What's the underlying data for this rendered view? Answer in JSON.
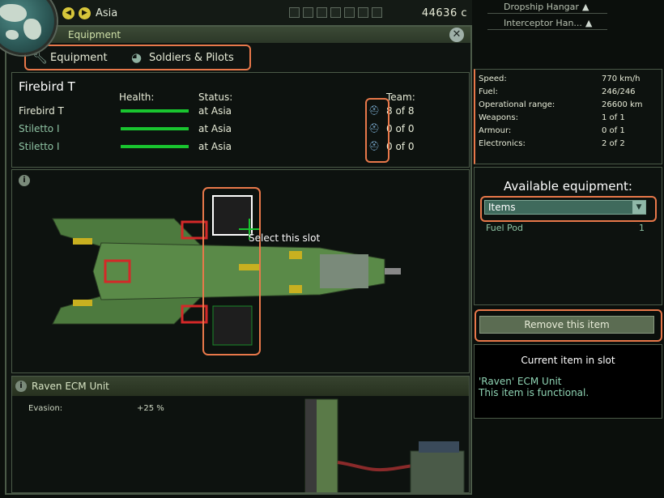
{
  "topbar": {
    "region": "Asia",
    "credits": "44636 c",
    "prev_icon": "left-arrow-icon",
    "next_icon": "right-arrow-icon"
  },
  "hangars": [
    {
      "label": "Dropship Hangar",
      "icon": "dropship-icon"
    },
    {
      "label": "Interceptor Han...",
      "icon": "interceptor-icon"
    }
  ],
  "panel": {
    "title": "Equipment",
    "tabs": [
      {
        "label": "Equipment",
        "icon": "wrench-icon"
      },
      {
        "label": "Soldiers & Pilots",
        "icon": "helmet-icon"
      }
    ]
  },
  "team": {
    "craft_title": "Firebird T",
    "headers": {
      "health": "Health:",
      "status": "Status:",
      "team": "Team:"
    },
    "rows": [
      {
        "name": "Firebird T",
        "health": 1.0,
        "status": "at Asia",
        "team": "8 of 8",
        "name_color": "#e8ecd8"
      },
      {
        "name": "Stiletto I",
        "health": 1.0,
        "status": "at Asia",
        "team": "0 of 0",
        "name_color": "#8fc4a4"
      },
      {
        "name": "Stiletto I",
        "health": 1.0,
        "status": "at Asia",
        "team": "0 of 0",
        "name_color": "#8fc4a4"
      }
    ]
  },
  "aircraft_view": {
    "slot_label": "Select this slot"
  },
  "item_detail": {
    "title": "Raven ECM Unit",
    "stat_label": "Evasion:",
    "stat_value": "+25 %"
  },
  "craft_stats": [
    {
      "label": "Speed:",
      "value": "770 km/h"
    },
    {
      "label": "Fuel:",
      "value": "246/246"
    },
    {
      "label": "Operational range:",
      "value": "26600 km"
    },
    {
      "label": "Weapons:",
      "value": "1 of 1"
    },
    {
      "label": "Armour:",
      "value": "0 of 1"
    },
    {
      "label": "Electronics:",
      "value": "2 of 2"
    }
  ],
  "available": {
    "title": "Available equipment:",
    "filter": "Items",
    "items": [
      {
        "name": "Fuel Pod",
        "count": "1"
      }
    ]
  },
  "actions": {
    "remove": "Remove this item"
  },
  "current_item": {
    "title": "Current item in slot",
    "name": "'Raven' ECM Unit",
    "status": "This item is functional."
  },
  "colors": {
    "highlight": "#e8784a",
    "health": "#19c52f",
    "accent": "#8fc4a4"
  }
}
